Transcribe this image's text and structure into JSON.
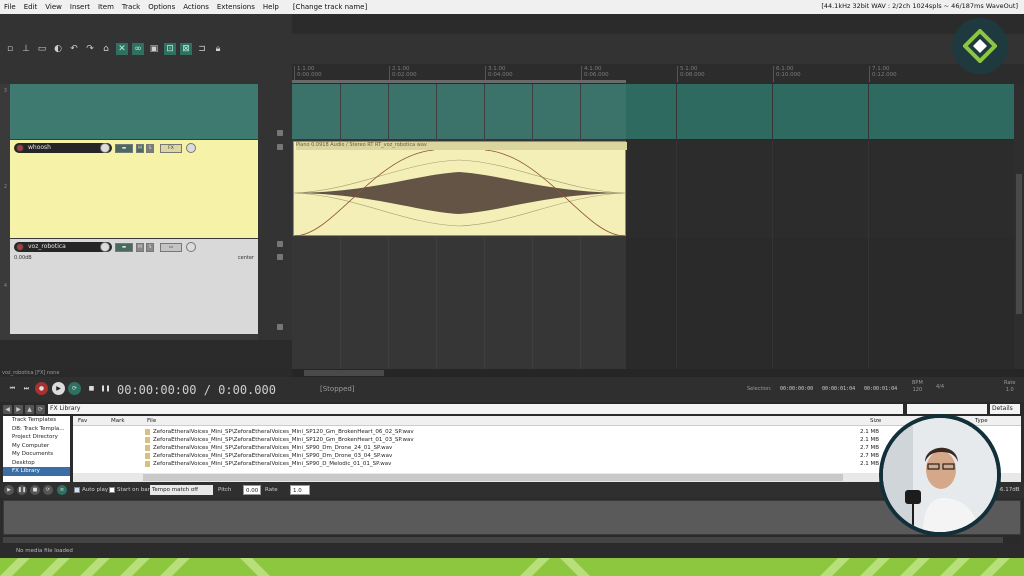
{
  "menubar": {
    "items": [
      "File",
      "Edit",
      "View",
      "Insert",
      "Item",
      "Track",
      "Options",
      "Actions",
      "Extensions",
      "Help"
    ],
    "window_title": "[Change track name]",
    "audio_status": "[44.1kHz 32bit WAV : 2/2ch 1024spls ~ 46/187ms WaveOut]"
  },
  "tracks": [
    {
      "number": "3",
      "name": "",
      "color": "#3f7a70"
    },
    {
      "number": "2",
      "name": "whoosh",
      "color": "#f6f3a8",
      "mute_label": "M",
      "solo_label": "S",
      "fx_label": "FX"
    },
    {
      "number": "4",
      "name": "voz_robotica",
      "color": "#d9d9d9",
      "volume": "0.00dB",
      "pan": "center",
      "mute_label": "M",
      "solo_label": "S"
    }
  ],
  "ruler": {
    "ticks": [
      {
        "bar": "1.1.00",
        "time": "0:00.000"
      },
      {
        "bar": "2.1.00",
        "time": "0:02.000"
      },
      {
        "bar": "3.1.00",
        "time": "0:04.000"
      },
      {
        "bar": "4.1.00",
        "time": "0:06.000"
      },
      {
        "bar": "5.1.00",
        "time": "0:08.000"
      },
      {
        "bar": "6.1.00",
        "time": "0:10.000"
      },
      {
        "bar": "7.1.00",
        "time": "0:12.000"
      }
    ]
  },
  "item": {
    "name": "Piano  0.0918 Audio / Stereo RT RT_voz_robotica wav"
  },
  "status_line": "voz_robotica [FX] none",
  "transport": {
    "time": "00:00:00:00 / 0:00.000",
    "state": "[Stopped]",
    "selection_label": "Selection:",
    "selection_start": "00:00:00:00",
    "selection_end": "00:00:01:04",
    "selection_length": "00:00:01:04",
    "bpm_label": "BPM",
    "bpm_value": "120",
    "sig_value": "4/4",
    "rate_label": "Rate",
    "rate_value": "1.0"
  },
  "media_explorer": {
    "path": "FX Library",
    "view_mode": "Details",
    "tree": [
      "Track Templates",
      "DB: Track Templa...",
      "Project Directory",
      "My Computer",
      "My Documents",
      "Desktop",
      "FX Library"
    ],
    "columns": {
      "fav": "Fav",
      "mark": "Mark",
      "file": "File",
      "size": "Size",
      "type": "Type"
    },
    "files": [
      {
        "name": "ZeforaEtheralVoices_Mini_SP\\ZeforaEtheralVoices_Mini_SP120_Gm_BrokenHeart_06_02_SP.wav",
        "size": "2.1 MB"
      },
      {
        "name": "ZeforaEtheralVoices_Mini_SP\\ZeforaEtheralVoices_Mini_SP120_Gm_BrokenHeart_01_03_SP.wav",
        "size": "2.1 MB"
      },
      {
        "name": "ZeforaEtheralVoices_Mini_SP\\ZeforaEtheralVoices_Mini_SP90_Dm_Drone_24_01_SP.wav",
        "size": "2.7 MB"
      },
      {
        "name": "ZeforaEtheralVoices_Mini_SP\\ZeforaEtheralVoices_Mini_SP90_Dm_Drone_03_04_SP.wav",
        "size": "2.7 MB"
      },
      {
        "name": "ZeforaEtheralVoices_Mini_SP\\ZeforaEtheralVoices_Mini_SP90_D_Melodic_01_01_SP.wav",
        "size": "2.1 MB"
      }
    ],
    "autoplay_label": "Auto play",
    "start_on_bar_label": "Start on bar",
    "tempo_match": "Tempo match off",
    "pitch_label": "Pitch",
    "pitch_value": "0.00",
    "rate_label": "Rate",
    "rate_value": "1.0",
    "volume_readout": "-6.17dB",
    "status": "No media file loaded"
  },
  "colors": {
    "accent_green": "#8dc63f",
    "logo_bg": "#1f3a3f",
    "webcam_ring": "#122f3a"
  }
}
